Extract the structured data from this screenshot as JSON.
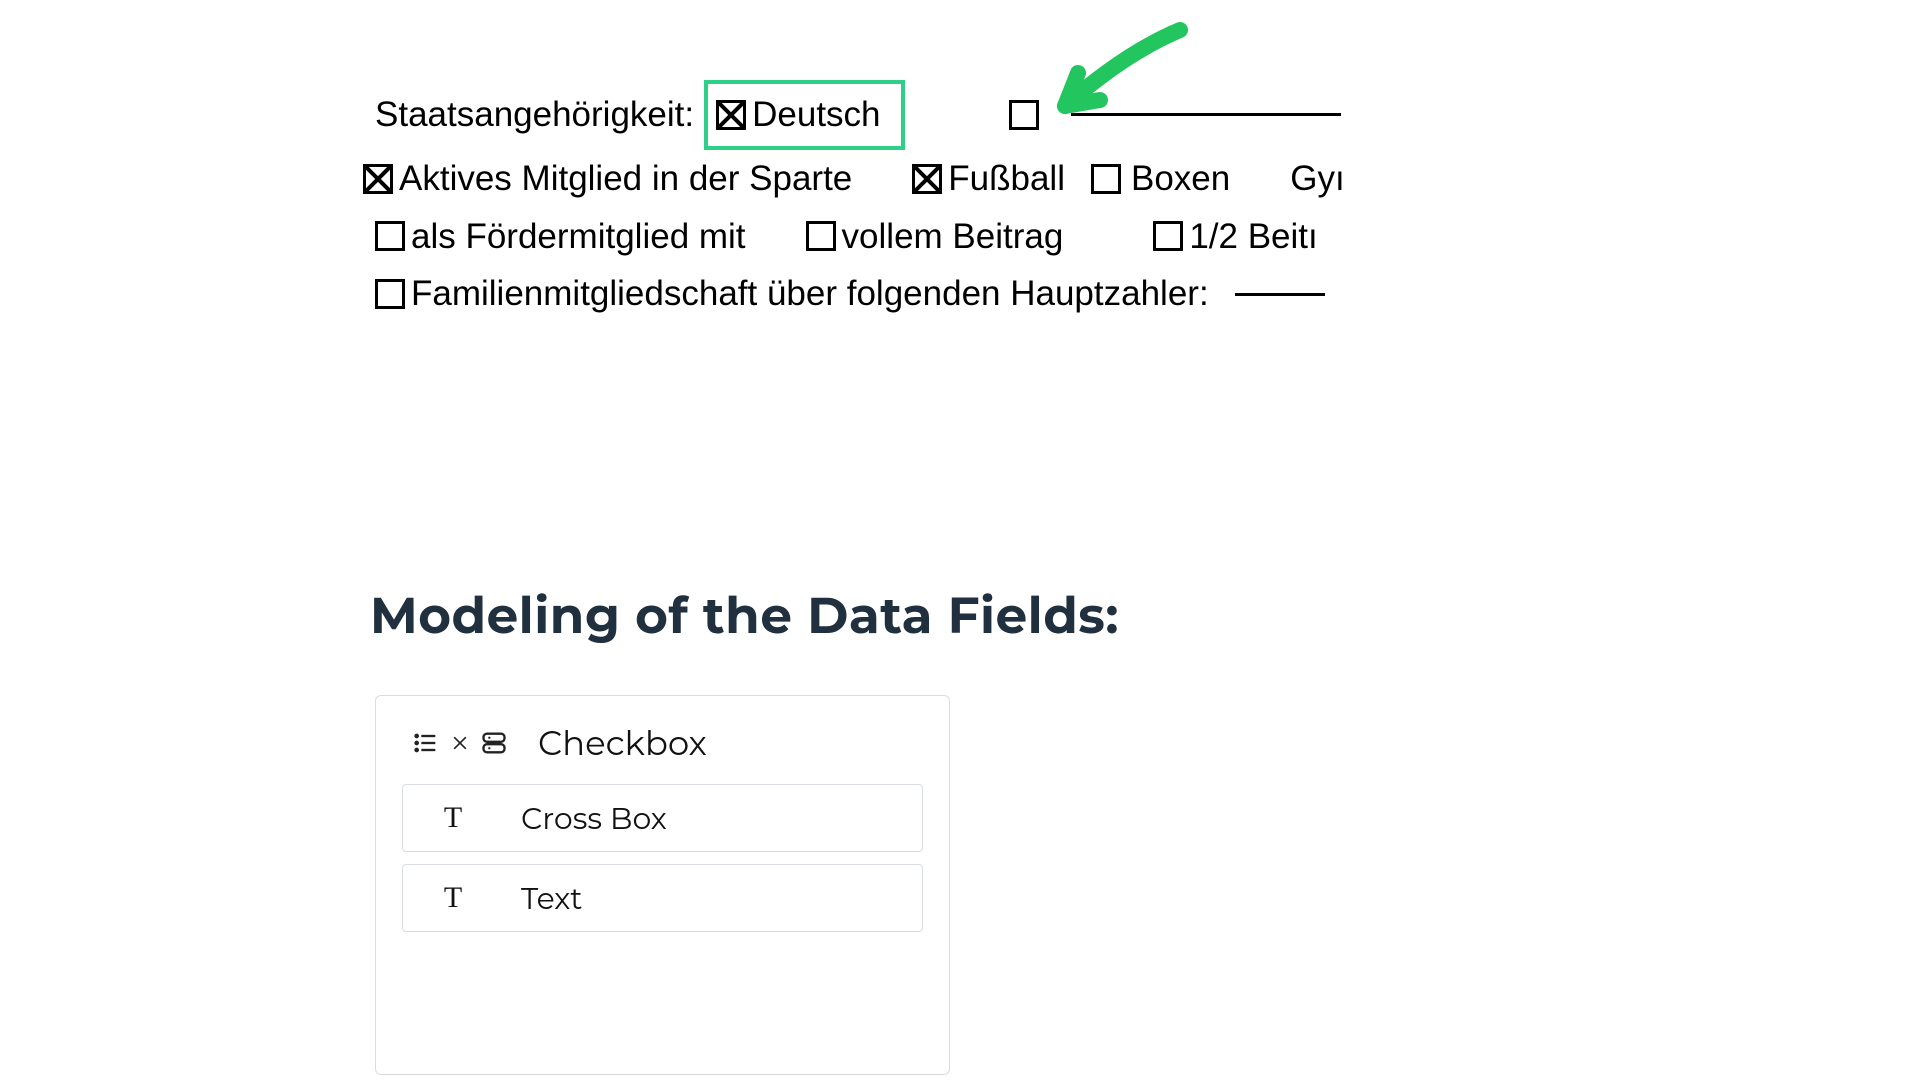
{
  "form": {
    "row1": {
      "label": "Staatsangehörigkeit:",
      "deutsch": {
        "checked": true,
        "text": "Deutsch"
      },
      "other": {
        "checked": false
      }
    },
    "row2": {
      "aktiv": {
        "checked": true,
        "text": "Aktives Mitglied in der Sparte"
      },
      "fussball": {
        "checked": true,
        "text": "Fußball"
      },
      "boxen": {
        "checked": false,
        "text": "Boxen"
      },
      "gy": {
        "text": "Gyı"
      }
    },
    "row3": {
      "foerder": {
        "checked": false,
        "text": "als Fördermitglied mit"
      },
      "voll": {
        "checked": false,
        "text": "vollem Beitrag"
      },
      "halb": {
        "checked": false,
        "text": "1/2 Beitı"
      }
    },
    "row4": {
      "familie": {
        "checked": false,
        "text": "Familienmitgliedschaft über folgenden Hauptzahler:"
      }
    }
  },
  "heading": "Modeling of the Data Fields:",
  "card": {
    "title": "Checkbox",
    "fields": [
      {
        "icon": "T",
        "label": "Cross Box"
      },
      {
        "icon": "T",
        "label": "Text"
      }
    ]
  },
  "colors": {
    "highlight": "#2ecf87"
  }
}
